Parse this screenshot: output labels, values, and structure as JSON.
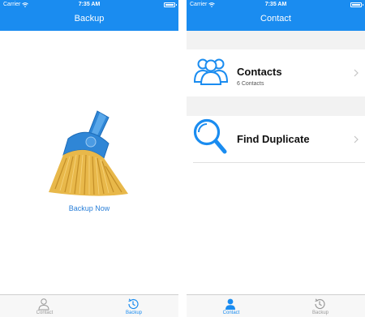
{
  "status_bar": {
    "carrier": "Carrier",
    "time": "7:35 AM"
  },
  "left_screen": {
    "title": "Backup",
    "backup_now_label": "Backup Now",
    "tabs": [
      {
        "label": "Contact",
        "active": false,
        "icon": "person-outline-icon"
      },
      {
        "label": "Backup",
        "active": true,
        "icon": "history-clock-icon"
      }
    ]
  },
  "right_screen": {
    "title": "Contact",
    "rows": [
      {
        "title": "Contacts",
        "subtitle": "6 Contacts",
        "icon": "people-group-icon"
      },
      {
        "title": "Find Duplicate",
        "icon": "magnifier-icon"
      }
    ],
    "tabs": [
      {
        "label": "Contact",
        "active": true,
        "icon": "person-filled-icon"
      },
      {
        "label": "Backup",
        "active": false,
        "icon": "history-clock-icon"
      }
    ]
  },
  "colors": {
    "accent": "#1a8cf0",
    "link": "#2a7fd8",
    "list_background": "#f2f2f2",
    "broom_handle": "#2f86d6",
    "broom_bristles": "#e8b84a"
  }
}
